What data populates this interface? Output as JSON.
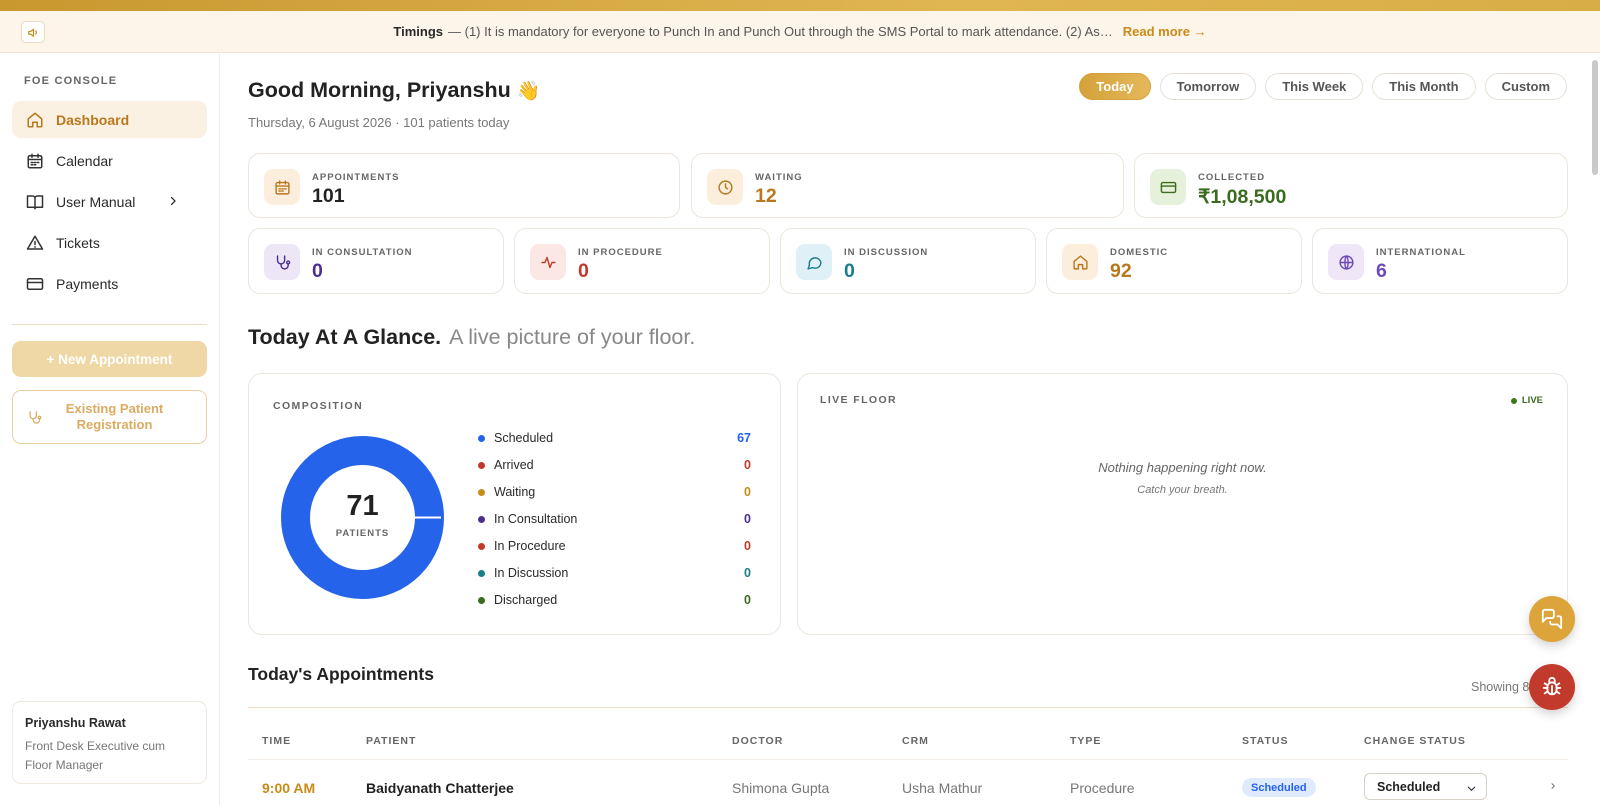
{
  "banner": {
    "title": "Timings",
    "text": "— (1) It is mandatory for everyone to Punch In and Punch Out through the SMS Portal to mark attendance. (2) As…",
    "link": "Read more →"
  },
  "sidebar": {
    "section_label": "FOE CONSOLE",
    "items": [
      {
        "label": "Dashboard",
        "icon": "home-icon"
      },
      {
        "label": "Calendar",
        "icon": "calendar-icon"
      },
      {
        "label": "User Manual",
        "icon": "book-icon"
      },
      {
        "label": "Tickets",
        "icon": "warning-icon"
      },
      {
        "label": "Payments",
        "icon": "card-icon"
      }
    ],
    "new_appointment": "+ New Appointment",
    "existing_patient": "Existing Patient Registration",
    "user": {
      "name": "Priyanshu Rawat",
      "role": "Front Desk Executive cum Floor Manager"
    }
  },
  "header": {
    "greeting": "Good Morning, Priyanshu",
    "wave": "👋",
    "subtitle": "Thursday, 6 August 2026 · 101 patients today",
    "ranges": [
      "Today",
      "Tomorrow",
      "This Week",
      "This Month",
      "Custom"
    ],
    "active_range": "Today"
  },
  "stats_top": [
    {
      "label": "APPOINTMENTS",
      "value": "101",
      "color": "#222222",
      "icon": "calendar-icon"
    },
    {
      "label": "WAITING",
      "value": "12",
      "color": "#b9781d",
      "icon": "clock-icon"
    },
    {
      "label": "COLLECTED",
      "value": "₹1,08,500",
      "color": "#3a6b1f",
      "icon": "card-icon"
    }
  ],
  "stats_bottom": [
    {
      "label": "IN CONSULTATION",
      "value": "0",
      "color": "#4c2e8f",
      "icon": "stethoscope-icon"
    },
    {
      "label": "IN PROCEDURE",
      "value": "0",
      "color": "#c0392b",
      "icon": "pulse-icon"
    },
    {
      "label": "IN DISCUSSION",
      "value": "0",
      "color": "#1a7d8a",
      "icon": "chat-icon"
    },
    {
      "label": "DOMESTIC",
      "value": "92",
      "color": "#b9781d",
      "icon": "home-icon"
    },
    {
      "label": "INTERNATIONAL",
      "value": "6",
      "color": "#6d4ab8",
      "icon": "globe-icon"
    }
  ],
  "glance": {
    "title": "Today At A Glance.",
    "subtitle": "A live picture of your floor."
  },
  "composition": {
    "title": "COMPOSITION",
    "total": "71",
    "total_label": "PATIENTS",
    "items": [
      {
        "label": "Scheduled",
        "count": "67",
        "color": "#2563eb"
      },
      {
        "label": "Arrived",
        "count": "0",
        "color": "#c0392b"
      },
      {
        "label": "Waiting",
        "count": "0",
        "color": "#c98a18"
      },
      {
        "label": "In Consultation",
        "count": "0",
        "color": "#4c2e8f"
      },
      {
        "label": "In Procedure",
        "count": "0",
        "color": "#c0392b"
      },
      {
        "label": "In Discussion",
        "count": "0",
        "color": "#1a7d8a"
      },
      {
        "label": "Discharged",
        "count": "0",
        "color": "#3a6b1f"
      }
    ]
  },
  "live_floor": {
    "title": "LIVE FLOOR",
    "badge": "LIVE",
    "empty_title": "Nothing happening right now.",
    "empty_sub": "Catch your breath."
  },
  "appointments": {
    "title": "Today's Appointments",
    "showing": "Showing 8",
    "columns": [
      "TIME",
      "PATIENT",
      "DOCTOR",
      "CRM",
      "TYPE",
      "STATUS",
      "CHANGE STATUS"
    ],
    "rows": [
      {
        "time": "9:00 AM",
        "patient": "Baidyanath Chatterjee",
        "doctor": "Shimona Gupta",
        "crm": "Usha Mathur",
        "type": "Procedure",
        "status": "Scheduled",
        "change_status": "Scheduled"
      }
    ]
  }
}
